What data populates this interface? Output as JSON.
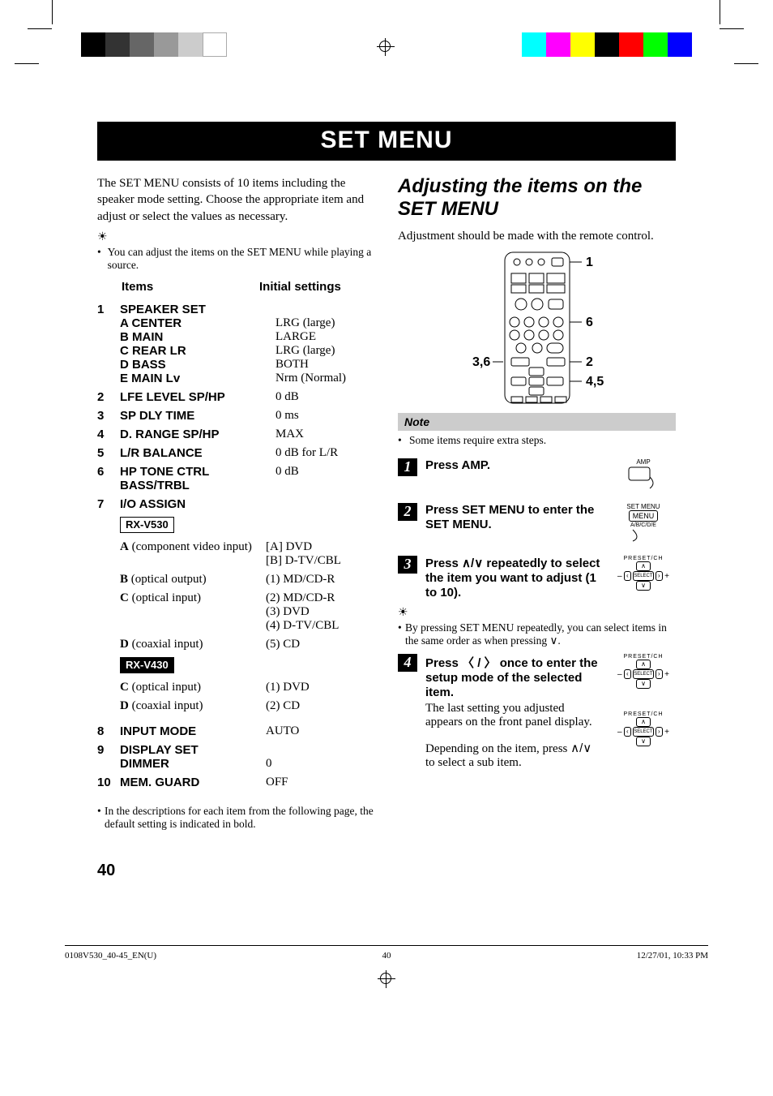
{
  "title": "SET MENU",
  "intro": "The SET MENU consists of 10 items including the speaker mode setting. Choose the appropriate item and adjust or select the values as necessary.",
  "tip_left": "You can adjust the items on the SET MENU while playing a source.",
  "col_head_items": "Items",
  "col_head_initial": "Initial settings",
  "rows": {
    "r1": {
      "n": "1",
      "name": "SPEAKER SET",
      "sub": [
        {
          "k": "A CENTER",
          "v": "LRG (large)"
        },
        {
          "k": "B MAIN",
          "v": "LARGE"
        },
        {
          "k": "C REAR LR",
          "v": "LRG (large)"
        },
        {
          "k": "D BASS",
          "v": "BOTH"
        },
        {
          "k": "E MAIN Lv",
          "v": "Nrm (Normal)"
        }
      ]
    },
    "r2": {
      "n": "2",
      "name": "LFE LEVEL SP/HP",
      "v": "0 dB"
    },
    "r3": {
      "n": "3",
      "name": "SP DLY TIME",
      "v": "0 ms"
    },
    "r4": {
      "n": "4",
      "name": "D. RANGE SP/HP",
      "v": "MAX"
    },
    "r5": {
      "n": "5",
      "name": "L/R BALANCE",
      "v": "0 dB for L/R"
    },
    "r6": {
      "n": "6",
      "name": "HP TONE CTRL BASS/TRBL",
      "v": "0 dB"
    },
    "r7": {
      "n": "7",
      "name": "I/O ASSIGN",
      "v": ""
    },
    "r8": {
      "n": "8",
      "name": "INPUT MODE",
      "v": "AUTO"
    },
    "r9": {
      "n": "9",
      "name": "DISPLAY SET"
    },
    "r9sub": {
      "k": "DIMMER",
      "v": "0"
    },
    "r10": {
      "n": "10",
      "name": "MEM. GUARD",
      "v": "OFF"
    }
  },
  "model530": "RX-V530",
  "model430": "RX-V430",
  "io530": [
    {
      "k": "A",
      "paren": " (component video input)",
      "v1": "[A] DVD",
      "v2": "[B] D-TV/CBL"
    },
    {
      "k": "B",
      "paren": " (optical output)",
      "v1": "(1) MD/CD-R"
    },
    {
      "k": "C",
      "paren": " (optical input)",
      "v1": "(2) MD/CD-R",
      "v2": "(3) DVD",
      "v3": "(4) D-TV/CBL"
    },
    {
      "k": "D",
      "paren": " (coaxial input)",
      "v1": "(5) CD"
    }
  ],
  "io430": [
    {
      "k": "C",
      "paren": " (optical input)",
      "v1": "(1) DVD"
    },
    {
      "k": "D",
      "paren": " (coaxial input)",
      "v1": "(2) CD"
    }
  ],
  "footnote": "In the descriptions for each item from the following page, the default setting is indicated in bold.",
  "right_heading": "Adjusting the items on the SET MENU",
  "right_intro": "Adjustment should be made with the remote control.",
  "remote_labels": {
    "a": "1",
    "b": "6",
    "c": "3,6",
    "d": "2",
    "e": "4,5"
  },
  "note_label": "Note",
  "note_item": "Some items require extra steps.",
  "steps": {
    "s1": {
      "lead": "Press AMP.",
      "icon": "AMP"
    },
    "s2": {
      "lead": "Press SET MENU to enter the SET MENU.",
      "icon1": "SET MENU",
      "icon2": "MENU",
      "icon3": "A/B/C/D/E"
    },
    "s3": {
      "lead_a": "Press ",
      "lead_b": " repeatedly to select the item you want to adjust (1 to 10)."
    },
    "tip3": "By pressing SET MENU repeatedly, you can select items in the same order as when pressing ",
    "s4": {
      "lead_a": "Press ",
      "lead_b": " once to enter the setup mode of the selected item.",
      "body": "The last setting you adjusted appears on the front panel display.",
      "body2a": "Depending on the item, press ",
      "body2b": " to select a sub item."
    }
  },
  "preset_label": "PRESET/CH",
  "select_label": "SELECT",
  "page_number": "40",
  "footer": {
    "file": "0108V530_40-45_EN(U)",
    "pg": "40",
    "ts": "12/27/01, 10:33 PM"
  }
}
